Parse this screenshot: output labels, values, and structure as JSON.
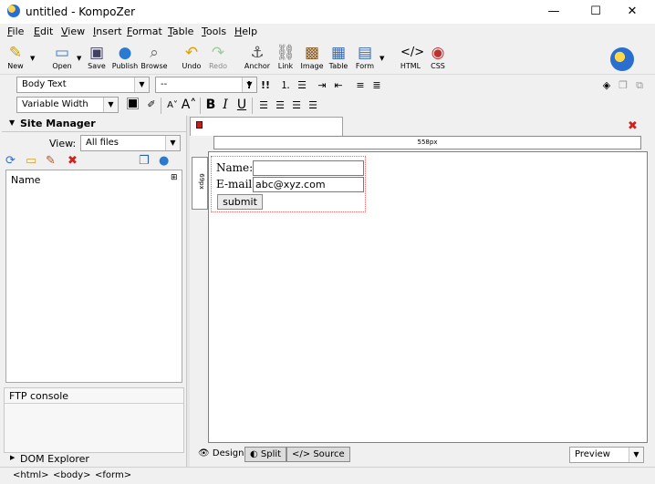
{
  "window": {
    "title": "untitled - KompoZer",
    "minimize": "—",
    "maximize": "☐",
    "close": "✕"
  },
  "menu": [
    "File",
    "Edit",
    "View",
    "Insert",
    "Format",
    "Table",
    "Tools",
    "Help"
  ],
  "toolbar": {
    "new": "New",
    "open": "Open",
    "save": "Save",
    "publish": "Publish",
    "browse": "Browse",
    "undo": "Undo",
    "redo": "Redo",
    "anchor": "Anchor",
    "link": "Link",
    "image": "Image",
    "table": "Table",
    "form": "Form",
    "html": "HTML",
    "css": "CSS"
  },
  "format": {
    "paragraph_style": "Body Text",
    "class_value": "--",
    "font_value": "Variable Width",
    "bold": "B",
    "italic": "I",
    "underline": "U"
  },
  "site_manager": {
    "title": "Site Manager",
    "view_label": "View:",
    "view_value": "All files",
    "column_name": "Name"
  },
  "ftp_console": "FTP console",
  "dom_explorer": "DOM Explorer",
  "ruler": {
    "horizontal": "558px",
    "vertical": "69px"
  },
  "form": {
    "name_label": "Name:",
    "name_value": "",
    "email_label": "E-mail",
    "email_value": "abc@xyz.com",
    "submit_label": "submit"
  },
  "view_tabs": {
    "design": "Design",
    "split": "Split",
    "source": "Source"
  },
  "preview_select": "Preview",
  "breadcrumbs": [
    "<html>",
    "<body>",
    "<form>"
  ]
}
